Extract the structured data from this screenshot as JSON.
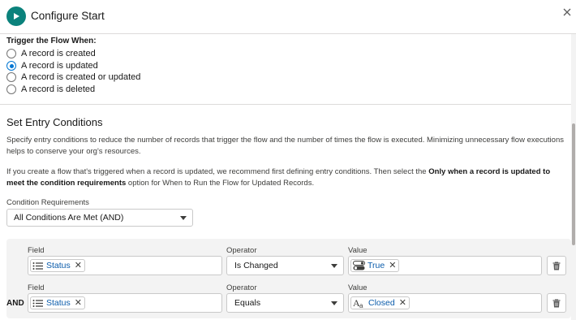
{
  "header": {
    "title": "Configure Start",
    "start_icon": "play-icon",
    "close_icon": "close-icon"
  },
  "trigger": {
    "label": "Trigger the Flow When:",
    "options": [
      {
        "label": "A record is created",
        "checked": false
      },
      {
        "label": "A record is updated",
        "checked": true
      },
      {
        "label": "A record is created or updated",
        "checked": false
      },
      {
        "label": "A record is deleted",
        "checked": false
      }
    ]
  },
  "entry": {
    "title": "Set Entry Conditions",
    "para1": "Specify entry conditions to reduce the number of records that trigger the flow and the number of times the flow is executed. Minimizing unnecessary flow executions helps to conserve your org's resources.",
    "para2_pre": "If you create a flow that's triggered when a record is updated, we recommend first defining entry conditions. Then select the ",
    "para2_bold": "Only when a record is updated to meet the condition requirements",
    "para2_post": " option for When to Run the Flow for Updated Records.",
    "requirements_label": "Condition Requirements",
    "requirements_value": "All Conditions Are Met (AND)"
  },
  "conditions": {
    "field_label": "Field",
    "operator_label": "Operator",
    "value_label": "Value",
    "logic_label": "AND",
    "rows": [
      {
        "field": "Status",
        "operator": "Is Changed",
        "value": "True",
        "value_icon": "toggle-icon"
      },
      {
        "field": "Status",
        "operator": "Equals",
        "value": "Closed",
        "value_icon": "text-icon"
      }
    ]
  },
  "colors": {
    "accent": "#0176d3",
    "start_icon_bg": "#0b827c",
    "pill_text": "#0b5cab"
  }
}
